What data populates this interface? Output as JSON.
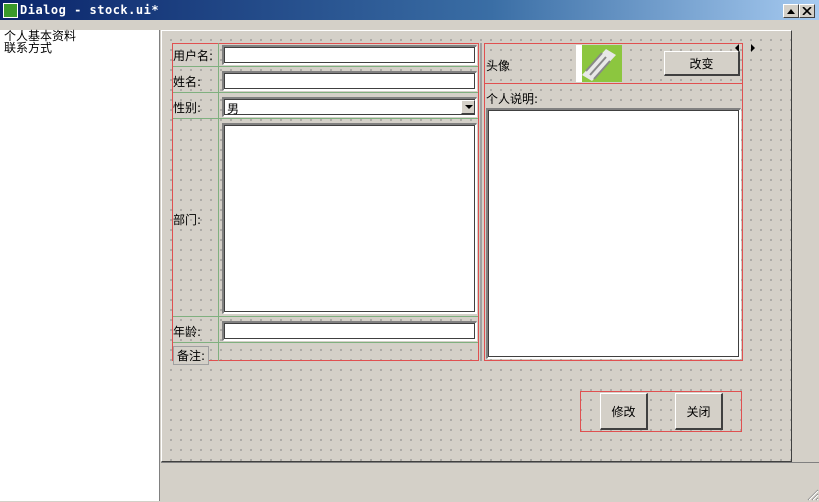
{
  "window": {
    "title": "Dialog - stock.ui*",
    "minimize_icon": "minimize-icon",
    "close_icon": "close-icon"
  },
  "sidebar": {
    "items": [
      "个人基本资料",
      "联系方式"
    ]
  },
  "form": {
    "username_label": "用户名:",
    "realname_label": "姓名:",
    "gender_label": "性别:",
    "gender_value": "男",
    "department_label": "部门:",
    "age_label": "年龄:",
    "note_label": "备注:"
  },
  "profile": {
    "avatar_label": "头像",
    "change_button": "改变",
    "description_label": "个人说明:"
  },
  "actions": {
    "modify_button": "修改",
    "close_button": "关闭"
  },
  "colors": {
    "layout_red": "#e05050",
    "layout_green": "#7fb07f",
    "titlebar": "#0a246a"
  }
}
